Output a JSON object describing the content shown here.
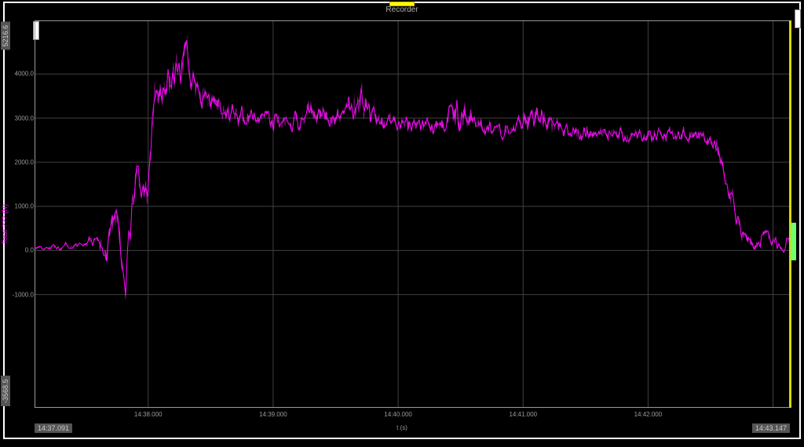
{
  "title": "Recorder",
  "ylabel": "Total ??? (N)",
  "xlabel": "t (s)",
  "y_max_label": "5216.6",
  "y_min_label": "-3568.5",
  "x_start_label": "14:37.091",
  "x_end_label": "14:43.147",
  "y_ticks": [
    "4000.0",
    "3000.0",
    "2000.0",
    "1000.0",
    "0.0",
    "-1000.0"
  ],
  "x_ticks": [
    "14:38.000",
    "14:39.000",
    "14:40.000",
    "14:41.000",
    "14:42.000"
  ],
  "chart_data": {
    "type": "line",
    "title": "Recorder",
    "xlabel": "t (s)",
    "ylabel": "Total (N)",
    "xlim": [
      877.091,
      883.147
    ],
    "ylim": [
      -3568.5,
      5216.6
    ],
    "series": [
      {
        "name": "Total",
        "color": "#ff00ff",
        "x": [
          877.091,
          877.3,
          877.45,
          877.6,
          877.65,
          877.75,
          877.82,
          877.9,
          878.0,
          878.05,
          878.1,
          878.2,
          878.3,
          878.4,
          878.5,
          878.7,
          878.9,
          879.1,
          879.3,
          879.5,
          879.7,
          879.9,
          880.1,
          880.3,
          880.5,
          880.7,
          880.9,
          881.1,
          881.3,
          881.5,
          881.7,
          881.9,
          882.1,
          882.3,
          882.4,
          882.45,
          882.55,
          882.65,
          882.75,
          882.85,
          882.95,
          883.05,
          883.147
        ],
        "y": [
          80,
          60,
          100,
          300,
          -200,
          800,
          -900,
          1700,
          1200,
          3400,
          3600,
          3800,
          4300,
          3700,
          3400,
          3100,
          3000,
          2900,
          3100,
          2950,
          3400,
          2900,
          2850,
          2800,
          3200,
          2750,
          2700,
          3100,
          2700,
          2650,
          2650,
          2620,
          2620,
          2600,
          2650,
          2550,
          2400,
          1400,
          400,
          100,
          350,
          100,
          200
        ],
        "noise_amplitude": [
          80,
          120,
          120,
          250,
          450,
          600,
          900,
          700,
          500,
          700,
          650,
          800,
          900,
          600,
          450,
          400,
          350,
          350,
          500,
          350,
          650,
          350,
          350,
          350,
          650,
          350,
          320,
          550,
          320,
          300,
          300,
          300,
          300,
          300,
          300,
          300,
          350,
          500,
          300,
          300,
          250,
          250,
          200
        ]
      }
    ]
  }
}
